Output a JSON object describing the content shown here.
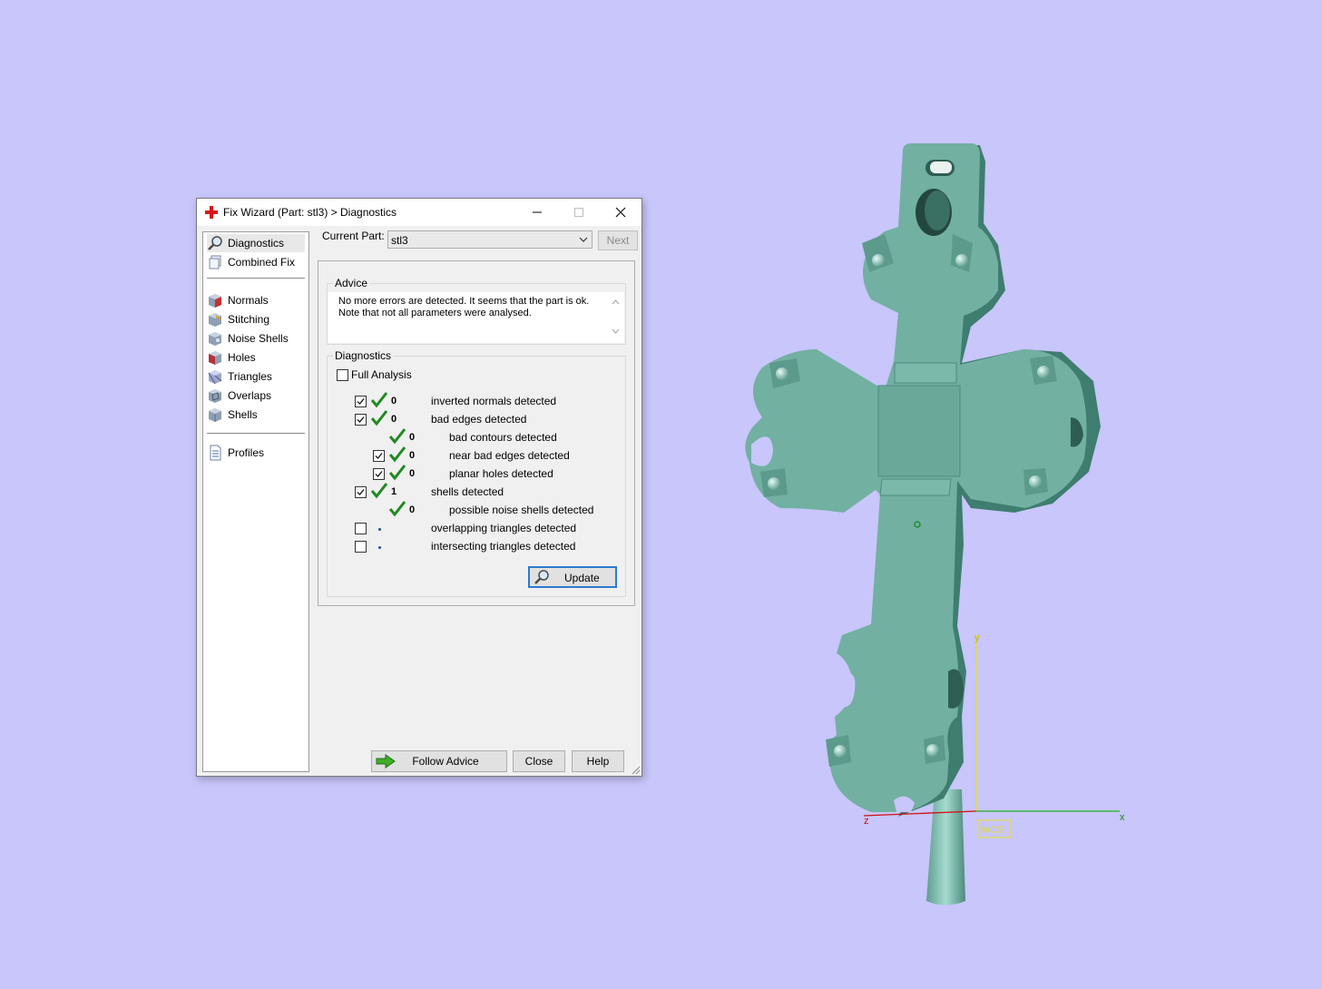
{
  "window": {
    "title": "Fix Wizard (Part: stl3) > Diagnostics"
  },
  "nav": {
    "items": [
      {
        "label": "Diagnostics"
      },
      {
        "label": "Combined Fix"
      },
      {
        "label": "Normals"
      },
      {
        "label": "Stitching"
      },
      {
        "label": "Noise Shells"
      },
      {
        "label": "Holes"
      },
      {
        "label": "Triangles"
      },
      {
        "label": "Overlaps"
      },
      {
        "label": "Shells"
      },
      {
        "label": "Profiles"
      }
    ]
  },
  "current_part": {
    "label": "Current Part:",
    "value": "stl3",
    "next_label": "Next"
  },
  "advice": {
    "title": "Advice",
    "text_line1": "No more errors are detected. It seems that the part is ok.",
    "text_line2": "Note that not all parameters were analysed."
  },
  "diagnostics": {
    "title": "Diagnostics",
    "full_analysis_label": "Full Analysis",
    "full_analysis_checked": false,
    "rows": [
      {
        "label": "inverted normals detected",
        "count": "0",
        "checked": true
      },
      {
        "label": "bad edges detected",
        "count": "0",
        "checked": true
      },
      {
        "label": "bad contours detected",
        "count": "0"
      },
      {
        "label": "near bad edges detected",
        "count": "0",
        "checked": true
      },
      {
        "label": "planar holes detected",
        "count": "0",
        "checked": true
      },
      {
        "label": "shells detected",
        "count": "1",
        "checked": true
      },
      {
        "label": "possible noise shells detected",
        "count": "0"
      },
      {
        "label": "overlapping triangles detected",
        "count": "",
        "checked": false
      },
      {
        "label": "intersecting triangles detected",
        "count": "",
        "checked": false
      }
    ],
    "update_label": "Update"
  },
  "footer": {
    "follow_advice_label": "Follow Advice",
    "close_label": "Close",
    "help_label": "Help"
  },
  "viewport": {
    "axis_y": "y",
    "axis_x": "x",
    "axis_z": "z",
    "wcs_label": "WCS",
    "colors": {
      "background": "#c8c6fb",
      "part": "#72b0a2",
      "axis_x": "#1db31d",
      "axis_y": "#e8e02a",
      "axis_z": "#d01010"
    }
  }
}
